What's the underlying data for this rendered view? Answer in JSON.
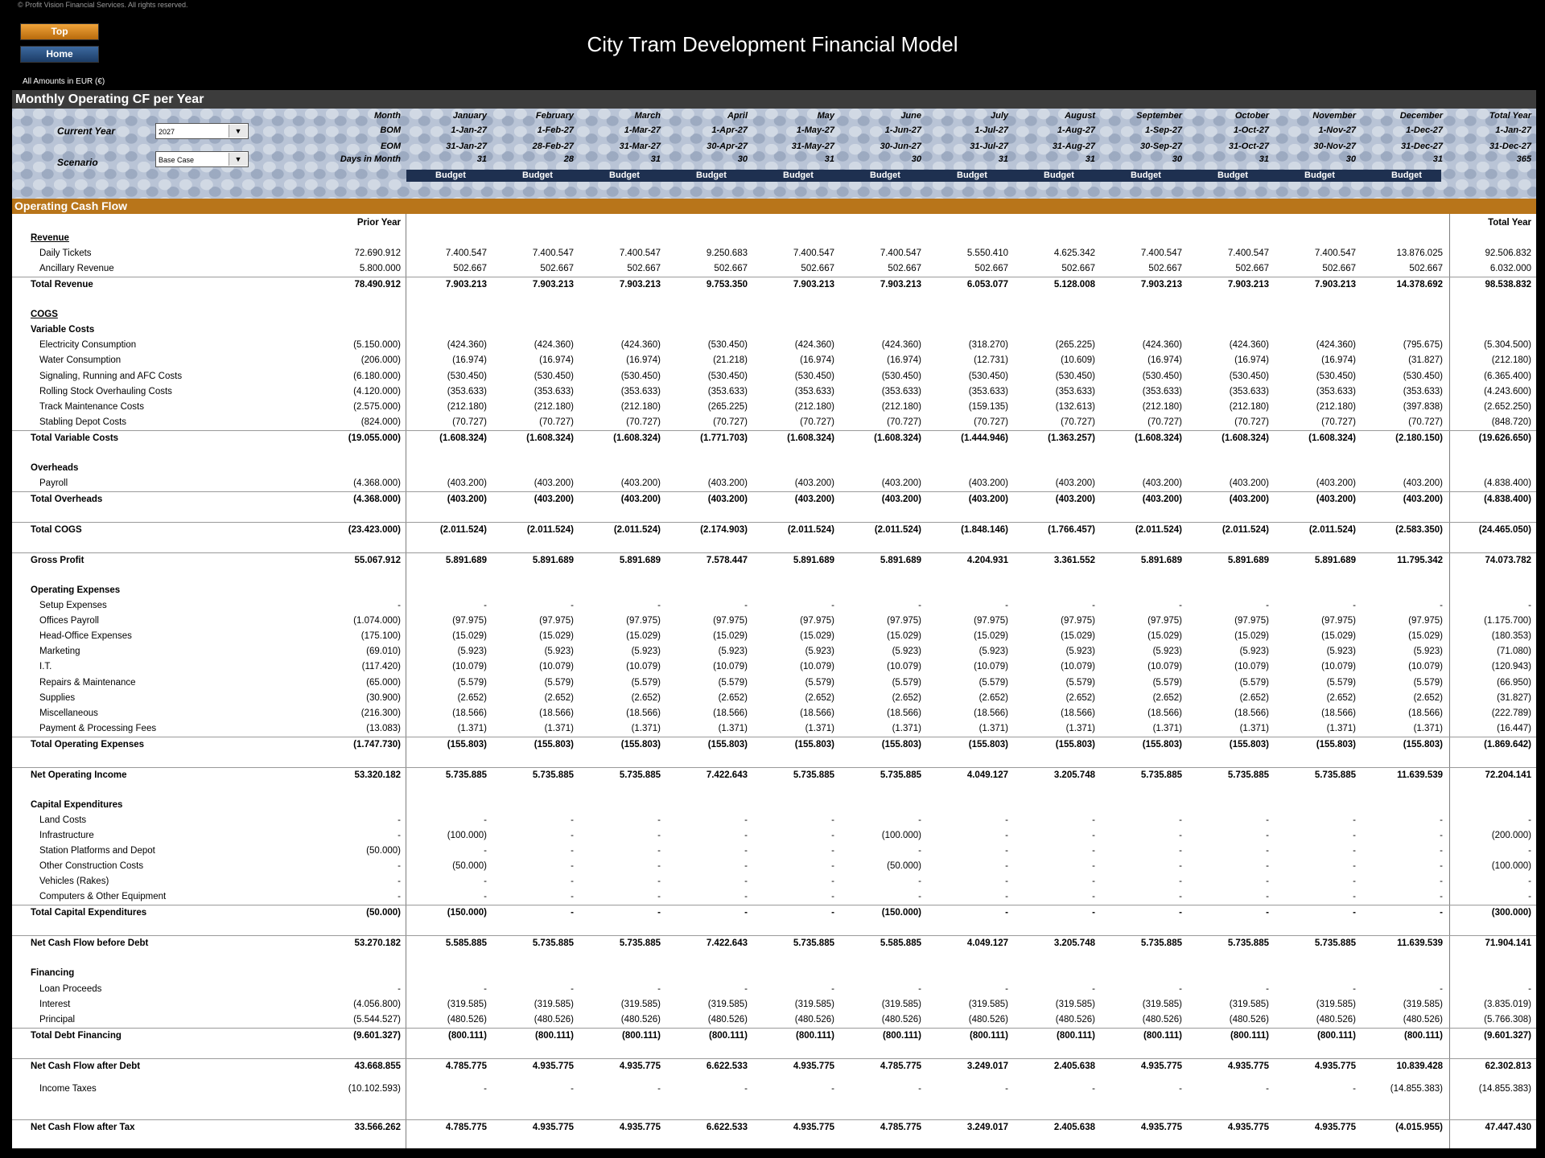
{
  "copyright": "© Profit Vision Financial Services. All rights reserved.",
  "nav": {
    "top_label": "Top",
    "home_label": "Home"
  },
  "title": "City Tram Development Financial Model",
  "amounts_note": "All Amounts in  EUR (€)",
  "sheet_title": "Monthly Operating CF per Year",
  "controls": {
    "current_year_label": "Current Year",
    "current_year_value": "2027",
    "scenario_label": "Scenario",
    "scenario_value": "Base Case"
  },
  "header": {
    "row_labels": [
      "Month",
      "BOM",
      "EOM",
      "Days in Month"
    ],
    "columns": [
      {
        "month": "January",
        "bom": "1-Jan-27",
        "eom": "31-Jan-27",
        "days": "31",
        "type": "Budget"
      },
      {
        "month": "February",
        "bom": "1-Feb-27",
        "eom": "28-Feb-27",
        "days": "28",
        "type": "Budget"
      },
      {
        "month": "March",
        "bom": "1-Mar-27",
        "eom": "31-Mar-27",
        "days": "31",
        "type": "Budget"
      },
      {
        "month": "April",
        "bom": "1-Apr-27",
        "eom": "30-Apr-27",
        "days": "30",
        "type": "Budget"
      },
      {
        "month": "May",
        "bom": "1-May-27",
        "eom": "31-May-27",
        "days": "31",
        "type": "Budget"
      },
      {
        "month": "June",
        "bom": "1-Jun-27",
        "eom": "30-Jun-27",
        "days": "30",
        "type": "Budget"
      },
      {
        "month": "July",
        "bom": "1-Jul-27",
        "eom": "31-Jul-27",
        "days": "31",
        "type": "Budget"
      },
      {
        "month": "August",
        "bom": "1-Aug-27",
        "eom": "31-Aug-27",
        "days": "31",
        "type": "Budget"
      },
      {
        "month": "September",
        "bom": "1-Sep-27",
        "eom": "30-Sep-27",
        "days": "30",
        "type": "Budget"
      },
      {
        "month": "October",
        "bom": "1-Oct-27",
        "eom": "31-Oct-27",
        "days": "31",
        "type": "Budget"
      },
      {
        "month": "November",
        "bom": "1-Nov-27",
        "eom": "30-Nov-27",
        "days": "30",
        "type": "Budget"
      },
      {
        "month": "December",
        "bom": "1-Dec-27",
        "eom": "31-Dec-27",
        "days": "31",
        "type": "Budget"
      }
    ],
    "total": {
      "month": "Total Year",
      "bom": "1-Jan-27",
      "eom": "31-Dec-27",
      "days": "365"
    }
  },
  "section_title": "Operating Cash Flow",
  "prior_year_label": "Prior Year",
  "total_year_label": "Total Year",
  "rows": [
    {
      "label": "Revenue",
      "kind": "head-u"
    },
    {
      "label": "Daily Tickets",
      "prior": "72.690.912",
      "m": [
        "7.400.547",
        "7.400.547",
        "7.400.547",
        "9.250.683",
        "7.400.547",
        "7.400.547",
        "5.550.410",
        "4.625.342",
        "7.400.547",
        "7.400.547",
        "7.400.547",
        "13.876.025"
      ],
      "total": "92.506.832"
    },
    {
      "label": "Ancillary Revenue",
      "prior": "5.800.000",
      "m": [
        "502.667",
        "502.667",
        "502.667",
        "502.667",
        "502.667",
        "502.667",
        "502.667",
        "502.667",
        "502.667",
        "502.667",
        "502.667",
        "502.667"
      ],
      "total": "6.032.000"
    },
    {
      "label": "Total Revenue",
      "kind": "total",
      "prior": "78.490.912",
      "m": [
        "7.903.213",
        "7.903.213",
        "7.903.213",
        "9.753.350",
        "7.903.213",
        "7.903.213",
        "6.053.077",
        "5.128.008",
        "7.903.213",
        "7.903.213",
        "7.903.213",
        "14.378.692"
      ],
      "total": "98.538.832"
    },
    {
      "kind": "blank"
    },
    {
      "label": "COGS",
      "kind": "head-u"
    },
    {
      "label": "Variable Costs",
      "kind": "head"
    },
    {
      "label": "Electricity Consumption",
      "prior": "(5.150.000)",
      "m": [
        "(424.360)",
        "(424.360)",
        "(424.360)",
        "(530.450)",
        "(424.360)",
        "(424.360)",
        "(318.270)",
        "(265.225)",
        "(424.360)",
        "(424.360)",
        "(424.360)",
        "(795.675)"
      ],
      "total": "(5.304.500)"
    },
    {
      "label": "Water Consumption",
      "prior": "(206.000)",
      "m": [
        "(16.974)",
        "(16.974)",
        "(16.974)",
        "(21.218)",
        "(16.974)",
        "(16.974)",
        "(12.731)",
        "(10.609)",
        "(16.974)",
        "(16.974)",
        "(16.974)",
        "(31.827)"
      ],
      "total": "(212.180)"
    },
    {
      "label": "Signaling, Running and AFC Costs",
      "prior": "(6.180.000)",
      "m": [
        "(530.450)",
        "(530.450)",
        "(530.450)",
        "(530.450)",
        "(530.450)",
        "(530.450)",
        "(530.450)",
        "(530.450)",
        "(530.450)",
        "(530.450)",
        "(530.450)",
        "(530.450)"
      ],
      "total": "(6.365.400)"
    },
    {
      "label": "Rolling Stock Overhauling Costs",
      "prior": "(4.120.000)",
      "m": [
        "(353.633)",
        "(353.633)",
        "(353.633)",
        "(353.633)",
        "(353.633)",
        "(353.633)",
        "(353.633)",
        "(353.633)",
        "(353.633)",
        "(353.633)",
        "(353.633)",
        "(353.633)"
      ],
      "total": "(4.243.600)"
    },
    {
      "label": "Track Maintenance Costs",
      "prior": "(2.575.000)",
      "m": [
        "(212.180)",
        "(212.180)",
        "(212.180)",
        "(265.225)",
        "(212.180)",
        "(212.180)",
        "(159.135)",
        "(132.613)",
        "(212.180)",
        "(212.180)",
        "(212.180)",
        "(397.838)"
      ],
      "total": "(2.652.250)"
    },
    {
      "label": "Stabling Depot Costs",
      "prior": "(824.000)",
      "m": [
        "(70.727)",
        "(70.727)",
        "(70.727)",
        "(70.727)",
        "(70.727)",
        "(70.727)",
        "(70.727)",
        "(70.727)",
        "(70.727)",
        "(70.727)",
        "(70.727)",
        "(70.727)"
      ],
      "total": "(848.720)"
    },
    {
      "label": "Total Variable Costs",
      "kind": "total",
      "prior": "(19.055.000)",
      "m": [
        "(1.608.324)",
        "(1.608.324)",
        "(1.608.324)",
        "(1.771.703)",
        "(1.608.324)",
        "(1.608.324)",
        "(1.444.946)",
        "(1.363.257)",
        "(1.608.324)",
        "(1.608.324)",
        "(1.608.324)",
        "(2.180.150)"
      ],
      "total": "(19.626.650)"
    },
    {
      "kind": "blank"
    },
    {
      "label": "Overheads",
      "kind": "head"
    },
    {
      "label": "Payroll",
      "prior": "(4.368.000)",
      "m": [
        "(403.200)",
        "(403.200)",
        "(403.200)",
        "(403.200)",
        "(403.200)",
        "(403.200)",
        "(403.200)",
        "(403.200)",
        "(403.200)",
        "(403.200)",
        "(403.200)",
        "(403.200)"
      ],
      "total": "(4.838.400)"
    },
    {
      "label": "Total Overheads",
      "kind": "total",
      "prior": "(4.368.000)",
      "m": [
        "(403.200)",
        "(403.200)",
        "(403.200)",
        "(403.200)",
        "(403.200)",
        "(403.200)",
        "(403.200)",
        "(403.200)",
        "(403.200)",
        "(403.200)",
        "(403.200)",
        "(403.200)"
      ],
      "total": "(4.838.400)"
    },
    {
      "kind": "blank"
    },
    {
      "label": "Total COGS",
      "kind": "total",
      "prior": "(23.423.000)",
      "m": [
        "(2.011.524)",
        "(2.011.524)",
        "(2.011.524)",
        "(2.174.903)",
        "(2.011.524)",
        "(2.011.524)",
        "(1.848.146)",
        "(1.766.457)",
        "(2.011.524)",
        "(2.011.524)",
        "(2.011.524)",
        "(2.583.350)"
      ],
      "total": "(24.465.050)"
    },
    {
      "kind": "blank"
    },
    {
      "label": "Gross Profit",
      "kind": "total",
      "prior": "55.067.912",
      "m": [
        "5.891.689",
        "5.891.689",
        "5.891.689",
        "7.578.447",
        "5.891.689",
        "5.891.689",
        "4.204.931",
        "3.361.552",
        "5.891.689",
        "5.891.689",
        "5.891.689",
        "11.795.342"
      ],
      "total": "74.073.782"
    },
    {
      "kind": "blank"
    },
    {
      "label": "Operating Expenses",
      "kind": "head"
    },
    {
      "label": "Setup Expenses",
      "prior": "-",
      "m": [
        "-",
        "-",
        "-",
        "-",
        "-",
        "-",
        "-",
        "-",
        "-",
        "-",
        "-",
        "-"
      ],
      "total": "-"
    },
    {
      "label": "Offices Payroll",
      "prior": "(1.074.000)",
      "m": [
        "(97.975)",
        "(97.975)",
        "(97.975)",
        "(97.975)",
        "(97.975)",
        "(97.975)",
        "(97.975)",
        "(97.975)",
        "(97.975)",
        "(97.975)",
        "(97.975)",
        "(97.975)"
      ],
      "total": "(1.175.700)"
    },
    {
      "label": "Head-Office Expenses",
      "prior": "(175.100)",
      "m": [
        "(15.029)",
        "(15.029)",
        "(15.029)",
        "(15.029)",
        "(15.029)",
        "(15.029)",
        "(15.029)",
        "(15.029)",
        "(15.029)",
        "(15.029)",
        "(15.029)",
        "(15.029)"
      ],
      "total": "(180.353)"
    },
    {
      "label": "Marketing",
      "prior": "(69.010)",
      "m": [
        "(5.923)",
        "(5.923)",
        "(5.923)",
        "(5.923)",
        "(5.923)",
        "(5.923)",
        "(5.923)",
        "(5.923)",
        "(5.923)",
        "(5.923)",
        "(5.923)",
        "(5.923)"
      ],
      "total": "(71.080)"
    },
    {
      "label": "I.T.",
      "prior": "(117.420)",
      "m": [
        "(10.079)",
        "(10.079)",
        "(10.079)",
        "(10.079)",
        "(10.079)",
        "(10.079)",
        "(10.079)",
        "(10.079)",
        "(10.079)",
        "(10.079)",
        "(10.079)",
        "(10.079)"
      ],
      "total": "(120.943)"
    },
    {
      "label": "Repairs & Maintenance",
      "prior": "(65.000)",
      "m": [
        "(5.579)",
        "(5.579)",
        "(5.579)",
        "(5.579)",
        "(5.579)",
        "(5.579)",
        "(5.579)",
        "(5.579)",
        "(5.579)",
        "(5.579)",
        "(5.579)",
        "(5.579)"
      ],
      "total": "(66.950)"
    },
    {
      "label": "Supplies",
      "prior": "(30.900)",
      "m": [
        "(2.652)",
        "(2.652)",
        "(2.652)",
        "(2.652)",
        "(2.652)",
        "(2.652)",
        "(2.652)",
        "(2.652)",
        "(2.652)",
        "(2.652)",
        "(2.652)",
        "(2.652)"
      ],
      "total": "(31.827)"
    },
    {
      "label": "Miscellaneous",
      "prior": "(216.300)",
      "m": [
        "(18.566)",
        "(18.566)",
        "(18.566)",
        "(18.566)",
        "(18.566)",
        "(18.566)",
        "(18.566)",
        "(18.566)",
        "(18.566)",
        "(18.566)",
        "(18.566)",
        "(18.566)"
      ],
      "total": "(222.789)"
    },
    {
      "label": "Payment & Processing Fees",
      "prior": "(13.083)",
      "m": [
        "(1.371)",
        "(1.371)",
        "(1.371)",
        "(1.371)",
        "(1.371)",
        "(1.371)",
        "(1.371)",
        "(1.371)",
        "(1.371)",
        "(1.371)",
        "(1.371)",
        "(1.371)"
      ],
      "total": "(16.447)"
    },
    {
      "label": "Total Operating Expenses",
      "kind": "total",
      "prior": "(1.747.730)",
      "m": [
        "(155.803)",
        "(155.803)",
        "(155.803)",
        "(155.803)",
        "(155.803)",
        "(155.803)",
        "(155.803)",
        "(155.803)",
        "(155.803)",
        "(155.803)",
        "(155.803)",
        "(155.803)"
      ],
      "total": "(1.869.642)"
    },
    {
      "kind": "blank"
    },
    {
      "label": "Net Operating Income",
      "kind": "total",
      "prior": "53.320.182",
      "m": [
        "5.735.885",
        "5.735.885",
        "5.735.885",
        "7.422.643",
        "5.735.885",
        "5.735.885",
        "4.049.127",
        "3.205.748",
        "5.735.885",
        "5.735.885",
        "5.735.885",
        "11.639.539"
      ],
      "total": "72.204.141"
    },
    {
      "kind": "blank"
    },
    {
      "label": "Capital Expenditures",
      "kind": "head"
    },
    {
      "label": "Land Costs",
      "prior": "-",
      "m": [
        "-",
        "-",
        "-",
        "-",
        "-",
        "-",
        "-",
        "-",
        "-",
        "-",
        "-",
        "-"
      ],
      "total": "-"
    },
    {
      "label": "Infrastructure",
      "prior": "-",
      "m": [
        "(100.000)",
        "-",
        "-",
        "-",
        "-",
        "(100.000)",
        "-",
        "-",
        "-",
        "-",
        "-",
        "-"
      ],
      "total": "(200.000)"
    },
    {
      "label": "Station Platforms and Depot",
      "prior": "(50.000)",
      "m": [
        "-",
        "-",
        "-",
        "-",
        "-",
        "-",
        "-",
        "-",
        "-",
        "-",
        "-",
        "-"
      ],
      "total": "-"
    },
    {
      "label": "Other Construction Costs",
      "prior": "-",
      "m": [
        "(50.000)",
        "-",
        "-",
        "-",
        "-",
        "(50.000)",
        "-",
        "-",
        "-",
        "-",
        "-",
        "-"
      ],
      "total": "(100.000)"
    },
    {
      "label": "Vehicles (Rakes)",
      "prior": "-",
      "m": [
        "-",
        "-",
        "-",
        "-",
        "-",
        "-",
        "-",
        "-",
        "-",
        "-",
        "-",
        "-"
      ],
      "total": "-"
    },
    {
      "label": "Computers & Other Equipment",
      "prior": "-",
      "m": [
        "-",
        "-",
        "-",
        "-",
        "-",
        "-",
        "-",
        "-",
        "-",
        "-",
        "-",
        "-"
      ],
      "total": "-"
    },
    {
      "label": "Total Capital Expenditures",
      "kind": "total",
      "prior": "(50.000)",
      "m": [
        "(150.000)",
        "-",
        "-",
        "-",
        "-",
        "(150.000)",
        "-",
        "-",
        "-",
        "-",
        "-",
        "-"
      ],
      "total": "(300.000)"
    },
    {
      "kind": "blank"
    },
    {
      "label": "Net Cash Flow before Debt",
      "kind": "total",
      "prior": "53.270.182",
      "m": [
        "5.585.885",
        "5.735.885",
        "5.735.885",
        "7.422.643",
        "5.735.885",
        "5.585.885",
        "4.049.127",
        "3.205.748",
        "5.735.885",
        "5.735.885",
        "5.735.885",
        "11.639.539"
      ],
      "total": "71.904.141"
    },
    {
      "kind": "blank"
    },
    {
      "label": "Financing",
      "kind": "head"
    },
    {
      "label": "Loan Proceeds",
      "prior": "-",
      "m": [
        "-",
        "-",
        "-",
        "-",
        "-",
        "-",
        "-",
        "-",
        "-",
        "-",
        "-",
        "-"
      ],
      "total": "-"
    },
    {
      "label": "Interest",
      "prior": "(4.056.800)",
      "m": [
        "(319.585)",
        "(319.585)",
        "(319.585)",
        "(319.585)",
        "(319.585)",
        "(319.585)",
        "(319.585)",
        "(319.585)",
        "(319.585)",
        "(319.585)",
        "(319.585)",
        "(319.585)"
      ],
      "total": "(3.835.019)"
    },
    {
      "label": "Principal",
      "prior": "(5.544.527)",
      "m": [
        "(480.526)",
        "(480.526)",
        "(480.526)",
        "(480.526)",
        "(480.526)",
        "(480.526)",
        "(480.526)",
        "(480.526)",
        "(480.526)",
        "(480.526)",
        "(480.526)",
        "(480.526)"
      ],
      "total": "(5.766.308)"
    },
    {
      "label": "Total Debt Financing",
      "kind": "total",
      "prior": "(9.601.327)",
      "m": [
        "(800.111)",
        "(800.111)",
        "(800.111)",
        "(800.111)",
        "(800.111)",
        "(800.111)",
        "(800.111)",
        "(800.111)",
        "(800.111)",
        "(800.111)",
        "(800.111)",
        "(800.111)"
      ],
      "total": "(9.601.327)"
    },
    {
      "kind": "blank"
    },
    {
      "label": "Net Cash Flow after Debt",
      "kind": "total",
      "prior": "43.668.855",
      "m": [
        "4.785.775",
        "4.935.775",
        "4.935.775",
        "6.622.533",
        "4.935.775",
        "4.785.775",
        "3.249.017",
        "2.405.638",
        "4.935.775",
        "4.935.775",
        "4.935.775",
        "10.839.428"
      ],
      "total": "62.302.813"
    },
    {
      "kind": "blank"
    },
    {
      "label": "Income Taxes",
      "kind": "tax",
      "prior": "(10.102.593)",
      "m": [
        "-",
        "-",
        "-",
        "-",
        "-",
        "-",
        "-",
        "-",
        "-",
        "-",
        "-",
        "(14.855.383)"
      ],
      "total": "(14.855.383)"
    },
    {
      "kind": "blank"
    },
    {
      "label": "Net Cash Flow after Tax",
      "kind": "total",
      "prior": "33.566.262",
      "m": [
        "4.785.775",
        "4.935.775",
        "4.935.775",
        "6.622.533",
        "4.935.775",
        "4.785.775",
        "3.249.017",
        "2.405.638",
        "4.935.775",
        "4.935.775",
        "4.935.775",
        "(4.015.955)"
      ],
      "total": "47.447.430"
    }
  ]
}
